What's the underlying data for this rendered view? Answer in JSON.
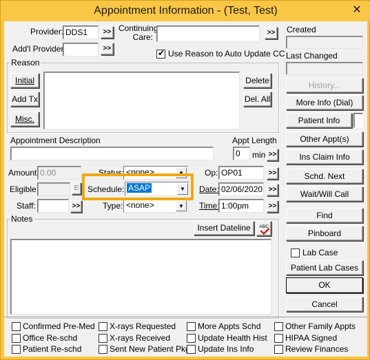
{
  "window": {
    "title": "Appointment Information - (Test, Test)",
    "close_glyph": "✕"
  },
  "provider": {
    "label": "Provider:",
    "value": "DDS1",
    "btn": ">>"
  },
  "addl_provider": {
    "label": "Add'l Provider:",
    "value": "",
    "btn": ">>"
  },
  "continuing_care": {
    "label_line1": "Continuing",
    "label_line2": "Care:",
    "value": "",
    "btn": ">>"
  },
  "use_reason": {
    "label": "Use Reason to Auto Update CC",
    "checked": true
  },
  "reason": {
    "group_label": "Reason",
    "initial": "Initial",
    "add_tx": "Add Tx",
    "misc": "Misc.",
    "delete": "Delete",
    "del_all": "Del. All"
  },
  "appt_desc": {
    "label": "Appointment Description",
    "value": ""
  },
  "appt_length": {
    "label": "Appt Length",
    "value": "0",
    "unit": "min",
    "btn": ">>"
  },
  "amount": {
    "label": "Amount:",
    "value": "0.00"
  },
  "eligible": {
    "label": "Eligible:",
    "value": "",
    "btn_glyph": "E"
  },
  "staff": {
    "label": "Staff:",
    "value": "",
    "btn": ">>"
  },
  "status": {
    "label": "Status:",
    "value": "<none>"
  },
  "schedule": {
    "label": "Schedule:",
    "value": "ASAP"
  },
  "type": {
    "label": "Type:",
    "value": "<none>"
  },
  "op": {
    "label": "Op:",
    "value": "OP01",
    "btn": ">>"
  },
  "date": {
    "label": "Date:",
    "value": "02/06/2020",
    "btn": ">>"
  },
  "time": {
    "label": "Time:",
    "value": "1:00pm",
    "btn": ">>"
  },
  "notes": {
    "group_label": "Notes",
    "insert_dateline": "Insert Dateline",
    "spell_glyph": "ABC"
  },
  "right_panel": {
    "created_label": "Created",
    "created_value": "",
    "last_changed_label": "Last Changed",
    "last_changed_value": "",
    "history": "History...",
    "more_info": "More Info (Dial)",
    "patient_info": "Patient Info",
    "other_appts": "Other Appt(s)",
    "ins_claim_info": "Ins Claim Info",
    "schd_next": "Schd. Next",
    "wait_will_call": "Wait/Will Call",
    "find": "Find",
    "pinboard": "Pinboard",
    "lab_case": "Lab Case",
    "patient_lab_cases": "Patient Lab Cases",
    "ok": "OK",
    "cancel": "Cancel"
  },
  "bottom_checks": [
    "Confirmed Pre-Med",
    "X-rays Requested",
    "More Appts Schd",
    "Other Family Appts",
    "Office Re-schd",
    "X-rays Received",
    "Update Health Hist",
    "HIPAA Signed",
    "Patient Re-schd",
    "Sent New Patient Pkg",
    "Update Ins Info",
    "Review Finances"
  ],
  "colors": {
    "title_bar": "#f9c646",
    "highlight": "#f1a90d",
    "selection": "#0078d7"
  }
}
